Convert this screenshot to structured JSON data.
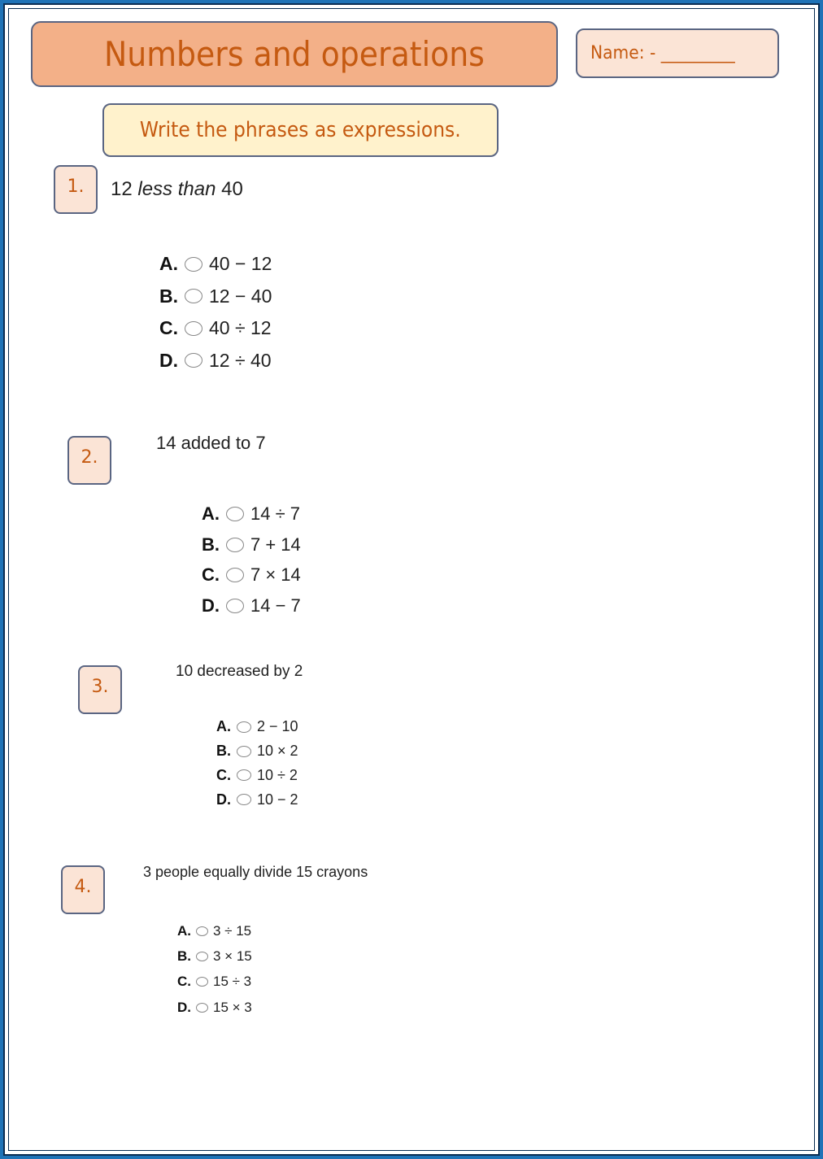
{
  "header": {
    "title": "Numbers and operations",
    "name_label": "Name: - _________",
    "instruction": "Write the phrases as expressions."
  },
  "colors": {
    "title_bg": "#f3b088",
    "accent_text": "#c55a11",
    "name_bg": "#fbe4d6",
    "instruction_bg": "#fff2cc",
    "frame_border": "#1f73b7"
  },
  "questions": [
    {
      "number": "1.",
      "phrase_parts": [
        "12 ",
        "less than",
        " 40"
      ],
      "options": [
        {
          "letter": "A.",
          "expression": "40 − 12"
        },
        {
          "letter": "B.",
          "expression": "12 − 40"
        },
        {
          "letter": "C.",
          "expression": "40 ÷ 12"
        },
        {
          "letter": "D.",
          "expression": "12 ÷ 40"
        }
      ]
    },
    {
      "number": "2.",
      "phrase": "14 added to 7",
      "options": [
        {
          "letter": "A.",
          "expression": "14 ÷ 7"
        },
        {
          "letter": "B.",
          "expression": "7 + 14"
        },
        {
          "letter": "C.",
          "expression": "7 × 14"
        },
        {
          "letter": "D.",
          "expression": "14 − 7"
        }
      ]
    },
    {
      "number": "3.",
      "phrase": "10 decreased by 2",
      "options": [
        {
          "letter": "A.",
          "expression": "2 − 10"
        },
        {
          "letter": "B.",
          "expression": "10 × 2"
        },
        {
          "letter": "C.",
          "expression": "10 ÷ 2"
        },
        {
          "letter": "D.",
          "expression": "10 − 2"
        }
      ]
    },
    {
      "number": "4.",
      "phrase": "3 people equally divide 15 crayons",
      "options": [
        {
          "letter": "A.",
          "expression": "3 ÷ 15"
        },
        {
          "letter": "B.",
          "expression": "3 × 15"
        },
        {
          "letter": "C.",
          "expression": "15 ÷ 3"
        },
        {
          "letter": "D.",
          "expression": "15 × 3"
        }
      ]
    }
  ]
}
